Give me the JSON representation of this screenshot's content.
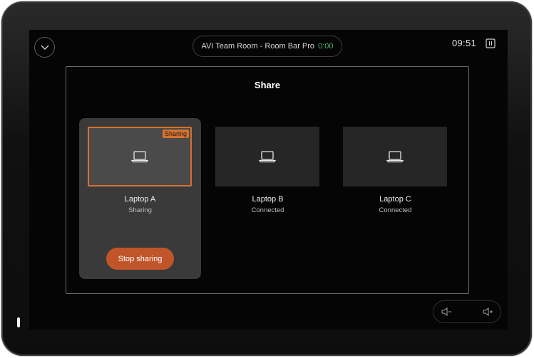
{
  "header": {
    "room_name": "AVI Team Room - Room Bar Pro",
    "call_timer": "0:00",
    "clock": "09:51"
  },
  "share_panel": {
    "title": "Share",
    "sources": [
      {
        "name": "Laptop A",
        "status": "Sharing",
        "badge": "Sharing",
        "active": true
      },
      {
        "name": "Laptop B",
        "status": "Connected",
        "active": false
      },
      {
        "name": "Laptop C",
        "status": "Connected",
        "active": false
      }
    ],
    "stop_label": "Stop sharing"
  },
  "colors": {
    "accent": "#d5732f",
    "button": "#c0552a",
    "timer": "#4caf6a"
  },
  "icons": [
    "chevron-down-icon",
    "layout-icon",
    "laptop-icon",
    "volume-down-icon",
    "volume-up-icon"
  ]
}
